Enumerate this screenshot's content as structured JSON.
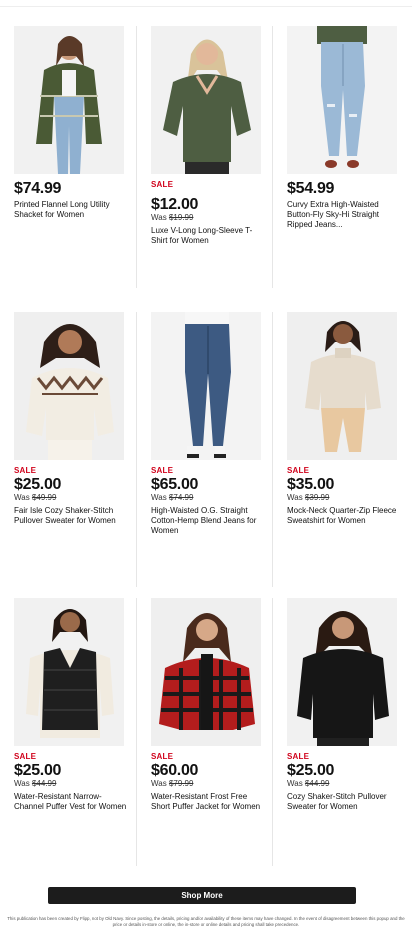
{
  "products": [
    {
      "sale": "",
      "price": "$74.99",
      "was_label": "",
      "was_price": "",
      "title": "Printed Flannel Long Utility Shacket for Women"
    },
    {
      "sale": "SALE",
      "price": "$12.00",
      "was_label": "Was ",
      "was_price": "$19.99",
      "title": "Luxe V-Long Long-Sleeve T-Shirt for Women"
    },
    {
      "sale": "",
      "price": "$54.99",
      "was_label": "",
      "was_price": "",
      "title": "Curvy Extra High-Waisted Button-Fly Sky-Hi Straight Ripped Jeans..."
    },
    {
      "sale": "SALE",
      "price": "$25.00",
      "was_label": "Was ",
      "was_price": "$49.99",
      "title": "Fair Isle Cozy Shaker-Stitch Pullover Sweater for Women"
    },
    {
      "sale": "SALE",
      "price": "$65.00",
      "was_label": "Was ",
      "was_price": "$74.99",
      "title": "High-Waisted O.G. Straight Cotton-Hemp Blend Jeans for Women"
    },
    {
      "sale": "SALE",
      "price": "$35.00",
      "was_label": "Was ",
      "was_price": "$39.99",
      "title": "Mock-Neck Quarter-Zip Fleece Sweatshirt for Women"
    },
    {
      "sale": "SALE",
      "price": "$25.00",
      "was_label": "Was ",
      "was_price": "$44.99",
      "title": "Water-Resistant Narrow-Channel Puffer Vest for Women"
    },
    {
      "sale": "SALE",
      "price": "$60.00",
      "was_label": "Was ",
      "was_price": "$79.99",
      "title": "Water-Resistant Frost Free Short Puffer Jacket for Women"
    },
    {
      "sale": "SALE",
      "price": "$25.00",
      "was_label": "Was ",
      "was_price": "$44.99",
      "title": "Cozy Shaker-Stitch Pullover Sweater for Women"
    }
  ],
  "shop_more_label": "Shop More",
  "disclaimer": "This publication has been created by Flipp, not by Old Navy. Since posting, the details, pricing and/or availability of these items may have changed. In the event of disagreement between this popup and the price or details in-store or online, the in-store or online details and pricing shall take precedence.",
  "colors": {
    "sale_red": "#d0021b",
    "button_dark": "#1c1c1c"
  }
}
